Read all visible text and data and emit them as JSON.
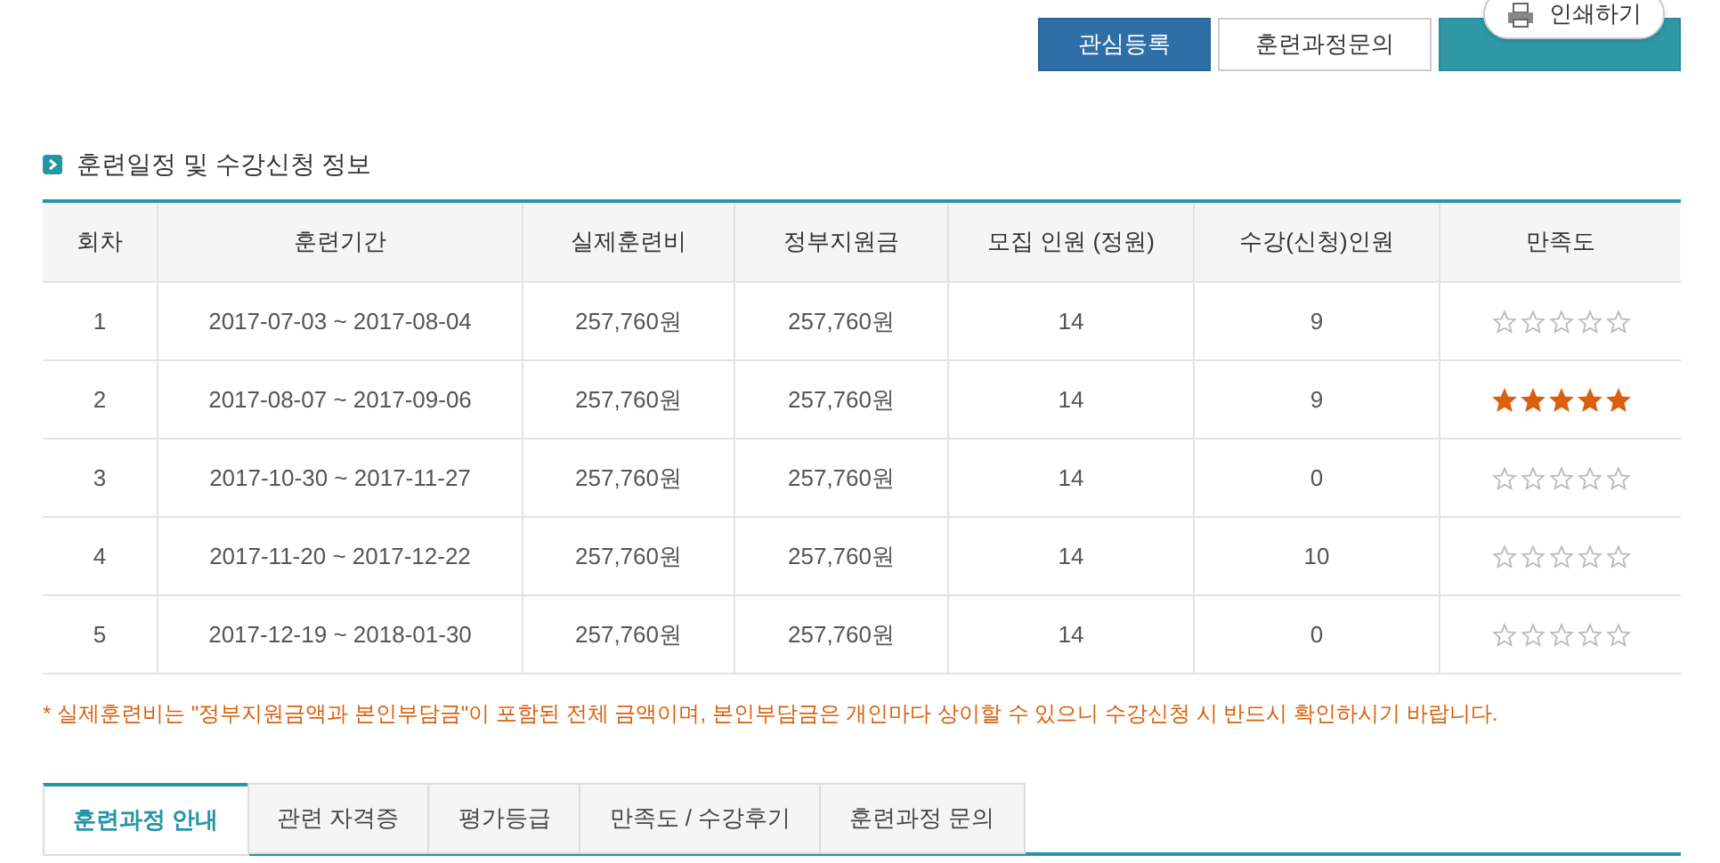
{
  "top_buttons": [
    {
      "label": "관심등록",
      "kind": "primary"
    },
    {
      "label": "훈련과정문의",
      "kind": "outline"
    },
    {
      "kind": "teal"
    }
  ],
  "print_popup": {
    "label": "인쇄하기"
  },
  "section_title": "훈련일정 및 수강신청 정보",
  "table": {
    "columns": [
      "회차",
      "훈련기간",
      "실제훈련비",
      "정부지원금",
      "모집 인원 (정원)",
      "수강(신청)인원",
      "만족도"
    ],
    "rows": [
      {
        "cells": [
          "1",
          "2017-07-03 ~ 2017-08-04",
          "257,760원",
          "257,760원",
          "14",
          "9"
        ],
        "stars": 0
      },
      {
        "cells": [
          "2",
          "2017-08-07 ~ 2017-09-06",
          "257,760원",
          "257,760원",
          "14",
          "9"
        ],
        "stars": 5
      },
      {
        "cells": [
          "3",
          "2017-10-30 ~ 2017-11-27",
          "257,760원",
          "257,760원",
          "14",
          "0"
        ],
        "stars": 0
      },
      {
        "cells": [
          "4",
          "2017-11-20 ~ 2017-12-22",
          "257,760원",
          "257,760원",
          "14",
          "10"
        ],
        "stars": 0
      },
      {
        "cells": [
          "5",
          "2017-12-19 ~ 2018-01-30",
          "257,760원",
          "257,760원",
          "14",
          "0"
        ],
        "stars": 0
      }
    ]
  },
  "note": "* 실제훈련비는 \"정부지원금액과 본인부담금\"이 포함된 전체 금액이며, 본인부담금은 개인마다 상이할 수 있으니 수강신청 시 반드시 확인하시기 바랍니다.",
  "tabs": [
    {
      "label": "훈련과정 안내",
      "selected": true
    },
    {
      "label": "관련 자격증",
      "selected": false
    },
    {
      "label": "평가등급",
      "selected": false
    },
    {
      "label": "만족도 / 수강후기",
      "selected": false
    },
    {
      "label": "훈련과정 문의",
      "selected": false
    }
  ]
}
